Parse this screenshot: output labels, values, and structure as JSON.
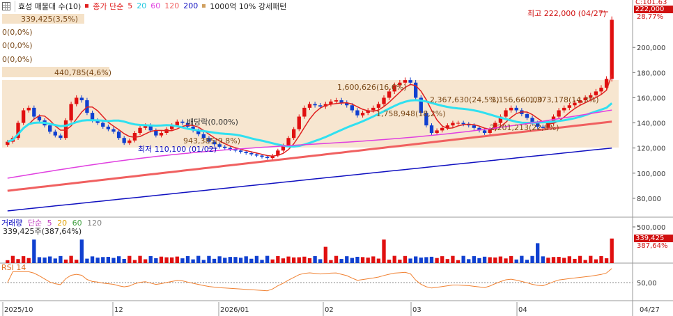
{
  "header": {
    "menu_icon": "grid-icon",
    "stock_name": "효성 매물대 수(10)",
    "legend_prefix": "종가 단순",
    "ma_periods": [
      "5",
      "20",
      "60",
      "120",
      "200"
    ],
    "ma_colors": [
      "#e02020",
      "#20d0e0",
      "#e040e0",
      "#f06060",
      "#1010c0"
    ],
    "volume_profile_label": "1000억 10% 강세패턴"
  },
  "price_axis": {
    "ticks": [
      "200,000",
      "180,000",
      "160,000",
      "140,000",
      "120,000",
      "100,000",
      "80,000"
    ],
    "top_tag": "222,000",
    "top_pct": "28,77%",
    "top_right_label": "C:101.63"
  },
  "volume_panel": {
    "legend_name": "거래량",
    "legend_ma": "단순",
    "legend_periods": [
      "5",
      "20",
      "60",
      "120"
    ],
    "legend_colors": [
      "#c040c0",
      "#e0a000",
      "#40a040",
      "#808080"
    ],
    "current_label": "339,425주(387,64%)",
    "ticks": [
      "500,000"
    ],
    "tag_value": "339,425",
    "tag_pct": "387,64%"
  },
  "rsi_panel": {
    "legend": "RSI 14",
    "ticks": [
      "50,00"
    ]
  },
  "x_axis": {
    "ticks": [
      "2025/10",
      "12",
      "2026/01",
      "02",
      "03",
      "04"
    ],
    "right_label": "04/27"
  },
  "annotations": {
    "volume_bands": [
      "339,425(3,5%)",
      "0(0,0%)",
      "0(0,0%)",
      "0(0,0%)",
      "440,785(4,6%)",
      "1,600,626(16,6%)",
      "1,758,948(18,2%)",
      "2,367,630(24,5%)",
      "3,156,660,00",
      "1,373,178(14,3%)",
      "2,201,213(22,8%)",
      "943,385(9,8%)"
    ],
    "high_label": "최고 222,000 (04/27)",
    "low_label": "최저 110,100 (01/02)",
    "dividend_label": "배당락(0,00%)",
    "ma_label_20": "1,373,178(14,3%)"
  },
  "chart_data": {
    "type": "candlestick",
    "x_range": [
      "2025/10",
      "04/27"
    ],
    "price_ylim": [
      65000,
      230000
    ],
    "close_approx": [
      125000,
      128000,
      140000,
      150000,
      152000,
      145000,
      142000,
      138000,
      133000,
      130000,
      128000,
      142000,
      155000,
      160000,
      158000,
      148000,
      142000,
      140000,
      137000,
      135000,
      133000,
      128000,
      124000,
      126000,
      132000,
      136000,
      138000,
      134000,
      130000,
      132000,
      135000,
      138000,
      141000,
      140000,
      137000,
      134000,
      131000,
      128000,
      125000,
      123000,
      121000,
      120000,
      119000,
      118000,
      117000,
      116000,
      115000,
      114000,
      113000,
      112000,
      114000,
      118000,
      122000,
      128000,
      135000,
      145000,
      152000,
      155000,
      154000,
      153000,
      155000,
      157000,
      158000,
      156000,
      154000,
      150000,
      146000,
      148000,
      150000,
      152000,
      155000,
      160000,
      165000,
      170000,
      172000,
      174000,
      172000,
      160000,
      148000,
      138000,
      132000,
      134000,
      136000,
      138000,
      140000,
      140000,
      139000,
      138000,
      136000,
      134000,
      132000,
      135000,
      140000,
      145000,
      150000,
      152000,
      150000,
      147000,
      144000,
      140000,
      137000,
      136000,
      140000,
      145000,
      150000,
      152000,
      154000,
      156000,
      158000,
      160000,
      162000,
      165000,
      168000,
      175000,
      222000
    ],
    "volume_max": 500000,
    "last_volume": 339425,
    "rsi_level_marker": 50,
    "high": 222000,
    "low": 110100
  }
}
